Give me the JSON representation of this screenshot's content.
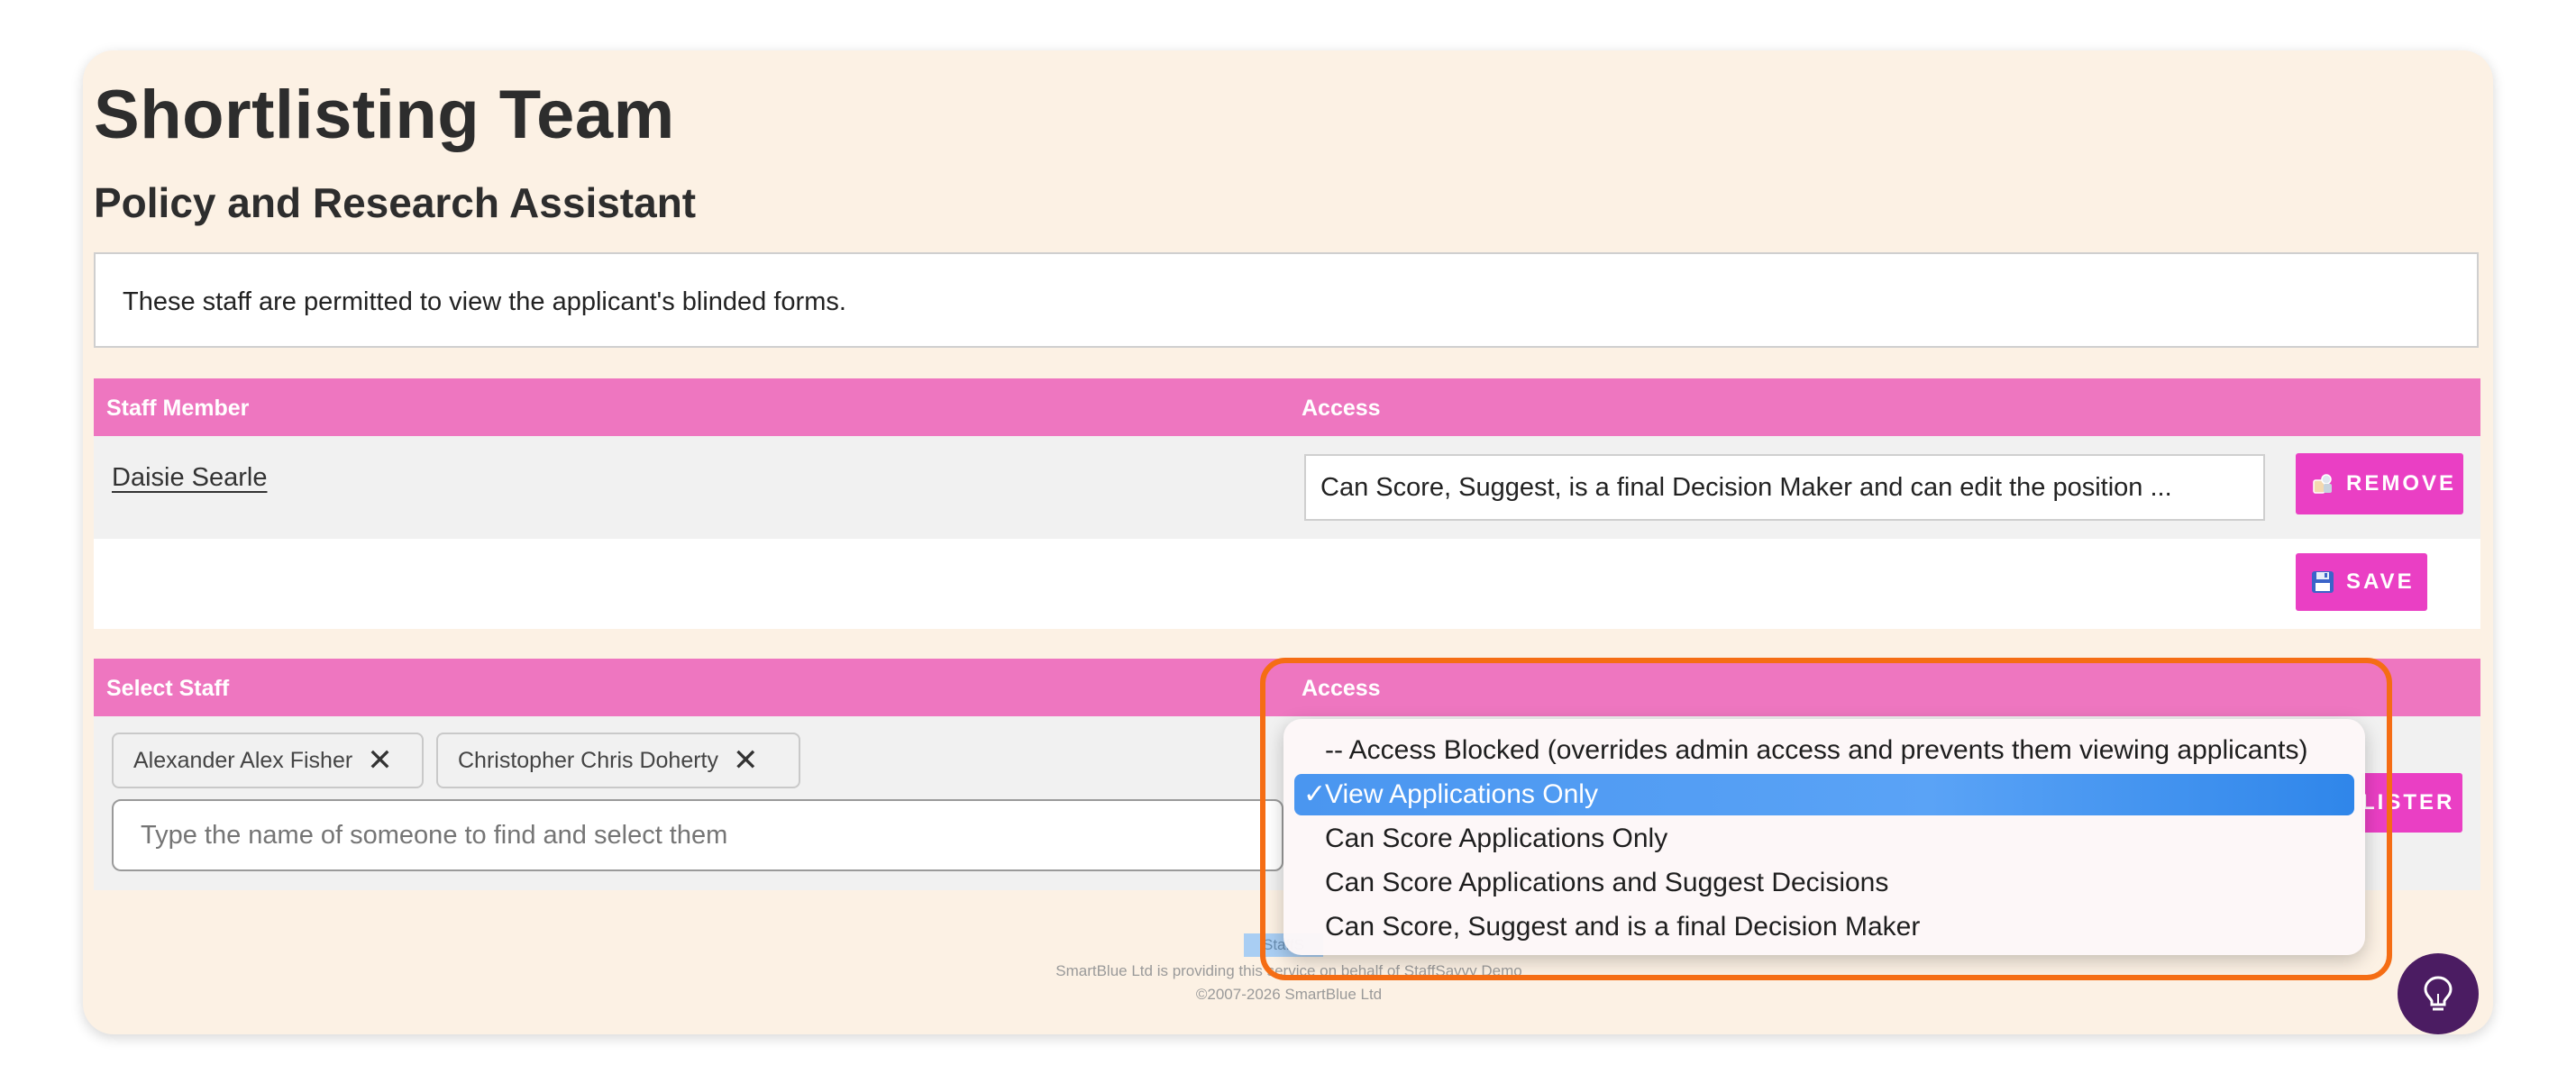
{
  "header": {
    "title": "Shortlisting Team",
    "subtitle": "Policy and Research Assistant"
  },
  "notice": "These staff are permitted to view the applicant's blinded forms.",
  "team_table": {
    "col_staff": "Staff Member",
    "col_access": "Access",
    "rows": [
      {
        "name": "Daisie Searle",
        "access": "Can Score, Suggest, is a final Decision Maker and can edit the position ...",
        "remove_label": "REMOVE"
      }
    ],
    "save_label": "SAVE"
  },
  "select_table": {
    "col_staff": "Select Staff",
    "col_access": "Access",
    "chips": [
      {
        "label": "Alexander Alex Fisher"
      },
      {
        "label": "Christopher Chris Doherty"
      }
    ],
    "search_placeholder": "Type the name of someone to find and select them",
    "register_label_partial": "LISTER"
  },
  "access_dropdown": {
    "selected_index": 1,
    "check_mark": "✓",
    "options": [
      "-- Access Blocked (overrides admin access and prevents them viewing applicants)",
      "View Applications Only",
      "Can Score Applications Only",
      "Can Score Applications and Suggest Decisions",
      "Can Score, Suggest and is a final Decision Maker"
    ]
  },
  "footer": {
    "selected_fragment": "StaffS",
    "provider_line": "SmartBlue Ltd is providing this service on behalf of StaffSavvy Demo",
    "copyright": "©2007-2026 SmartBlue Ltd"
  },
  "icons": {
    "remove": "remove-icon",
    "save": "floppy-disk-icon",
    "chip_close": "close-icon",
    "help": "lightbulb-icon"
  },
  "colors": {
    "card_bg": "#fcf1e4",
    "table_header": "#ee76c0",
    "button_pink": "#ea3fc4",
    "selected_option": "#4a96f0",
    "highlight_orange": "#f56d14",
    "help_button": "#4b1c62"
  }
}
